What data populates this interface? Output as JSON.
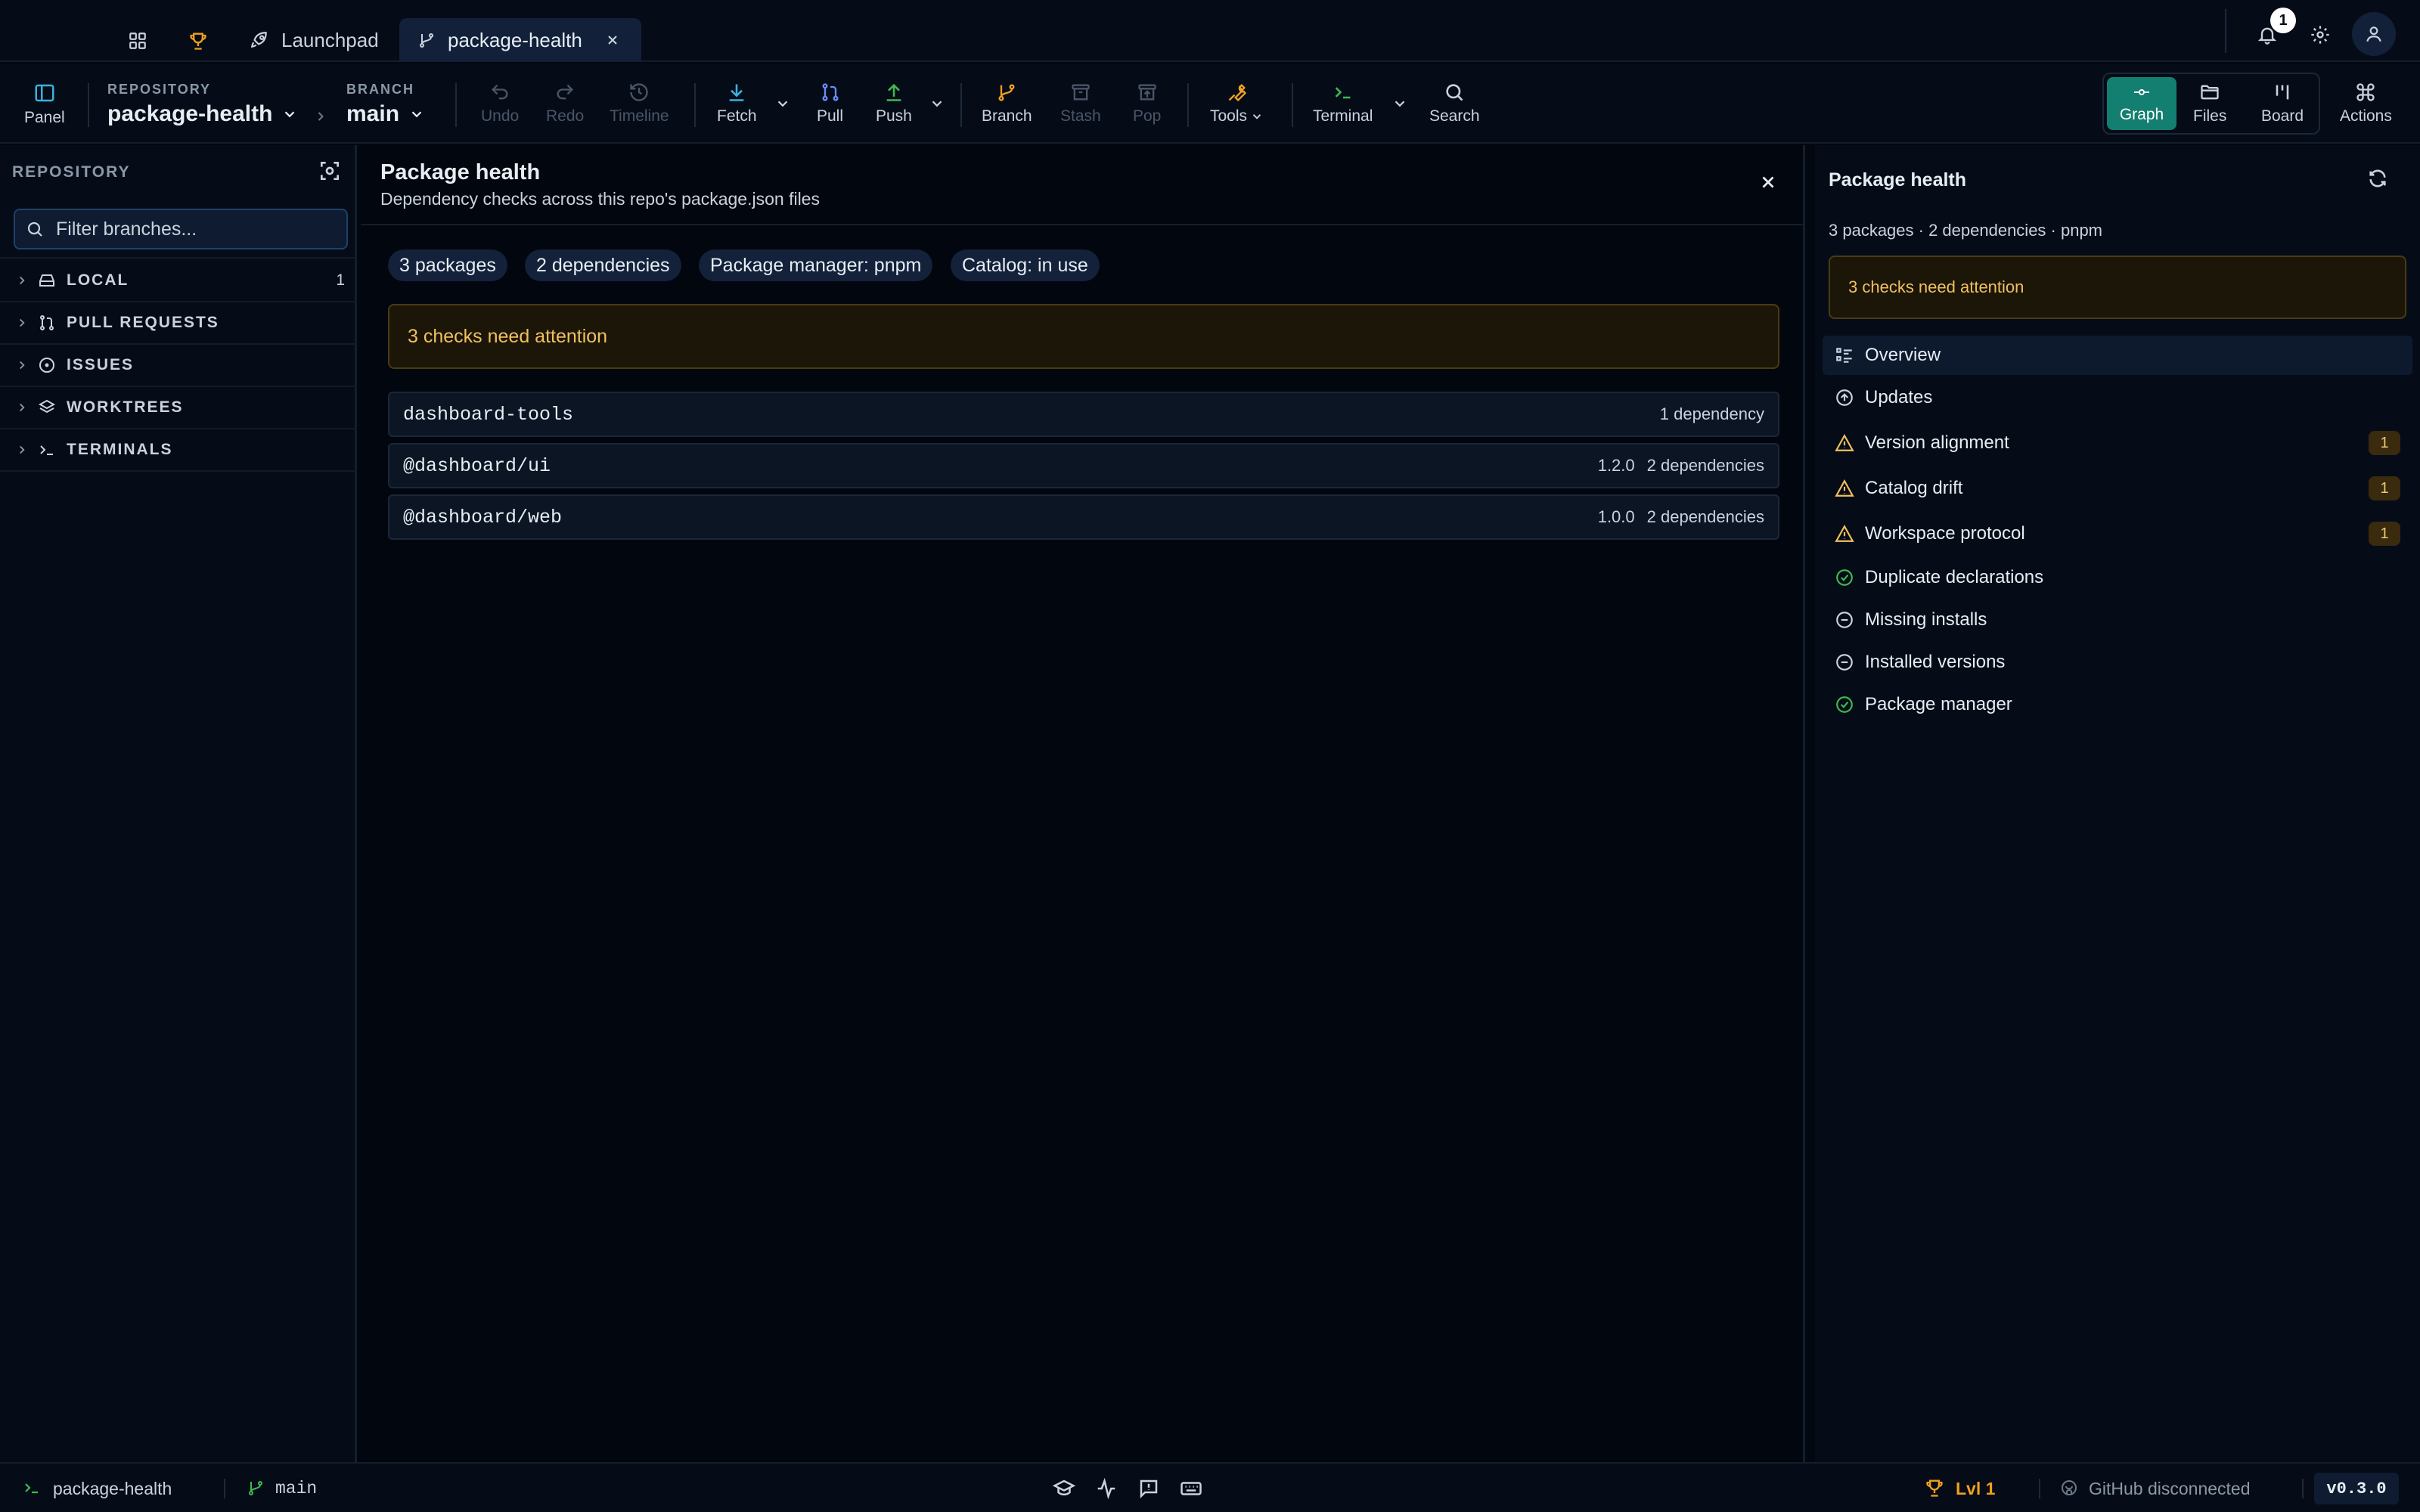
{
  "tabs": {
    "launchpad": "Launchpad",
    "repo_tab": "package-health",
    "notification_count": "1"
  },
  "toolbar": {
    "panel": "Panel",
    "repository_label": "REPOSITORY",
    "repository_value": "package-health",
    "branch_label": "BRANCH",
    "branch_value": "main",
    "undo": "Undo",
    "redo": "Redo",
    "timeline": "Timeline",
    "fetch": "Fetch",
    "pull": "Pull",
    "push": "Push",
    "branch": "Branch",
    "stash": "Stash",
    "pop": "Pop",
    "tools": "Tools",
    "terminal": "Terminal",
    "search": "Search",
    "views": [
      "Graph",
      "Files",
      "Board"
    ],
    "actions": "Actions"
  },
  "sidebar": {
    "header": "REPOSITORY",
    "filter_placeholder": "Filter branches...",
    "items": [
      {
        "label": "LOCAL",
        "count": "1"
      },
      {
        "label": "PULL REQUESTS",
        "count": ""
      },
      {
        "label": "ISSUES",
        "count": ""
      },
      {
        "label": "WORKTREES",
        "count": ""
      },
      {
        "label": "TERMINALS",
        "count": ""
      }
    ]
  },
  "main": {
    "title": "Package health",
    "subtitle": "Dependency checks across this repo's package.json files",
    "chips": [
      "3 packages",
      "2 dependencies",
      "Package manager: pnpm",
      "Catalog: in use"
    ],
    "alert": "3 checks need attention",
    "packages": [
      {
        "name": "dashboard-tools",
        "version": "",
        "deps": "1 dependency"
      },
      {
        "name": "@dashboard/ui",
        "version": "1.2.0",
        "deps": "2 dependencies"
      },
      {
        "name": "@dashboard/web",
        "version": "1.0.0",
        "deps": "2 dependencies"
      }
    ]
  },
  "right_panel": {
    "title": "Package health",
    "summary": "3 packages · 2 dependencies · pnpm",
    "alert": "3 checks need attention",
    "checks": [
      {
        "label": "Overview",
        "icon": "list-icon",
        "badge": ""
      },
      {
        "label": "Updates",
        "icon": "arrow-up-circle-icon",
        "badge": ""
      },
      {
        "label": "Version alignment",
        "icon": "warning-icon",
        "badge": "1"
      },
      {
        "label": "Catalog drift",
        "icon": "warning-icon",
        "badge": "1"
      },
      {
        "label": "Workspace protocol",
        "icon": "warning-icon",
        "badge": "1"
      },
      {
        "label": "Duplicate declarations",
        "icon": "check-circle-icon",
        "badge": ""
      },
      {
        "label": "Missing installs",
        "icon": "minus-circle-icon",
        "badge": ""
      },
      {
        "label": "Installed versions",
        "icon": "minus-circle-icon",
        "badge": ""
      },
      {
        "label": "Package manager",
        "icon": "check-circle-icon",
        "badge": ""
      }
    ]
  },
  "statusbar": {
    "repo": "package-health",
    "branch": "main",
    "level": "Lvl 1",
    "github": "GitHub disconnected",
    "version": "v0.3.0"
  },
  "colors": {
    "accent_teal": "#1a8a7a",
    "warning": "#f0c060",
    "success": "#3fb950",
    "fetch_blue": "#3ab0e0",
    "push_green": "#3fb950",
    "branch_orange": "#f0a020"
  }
}
